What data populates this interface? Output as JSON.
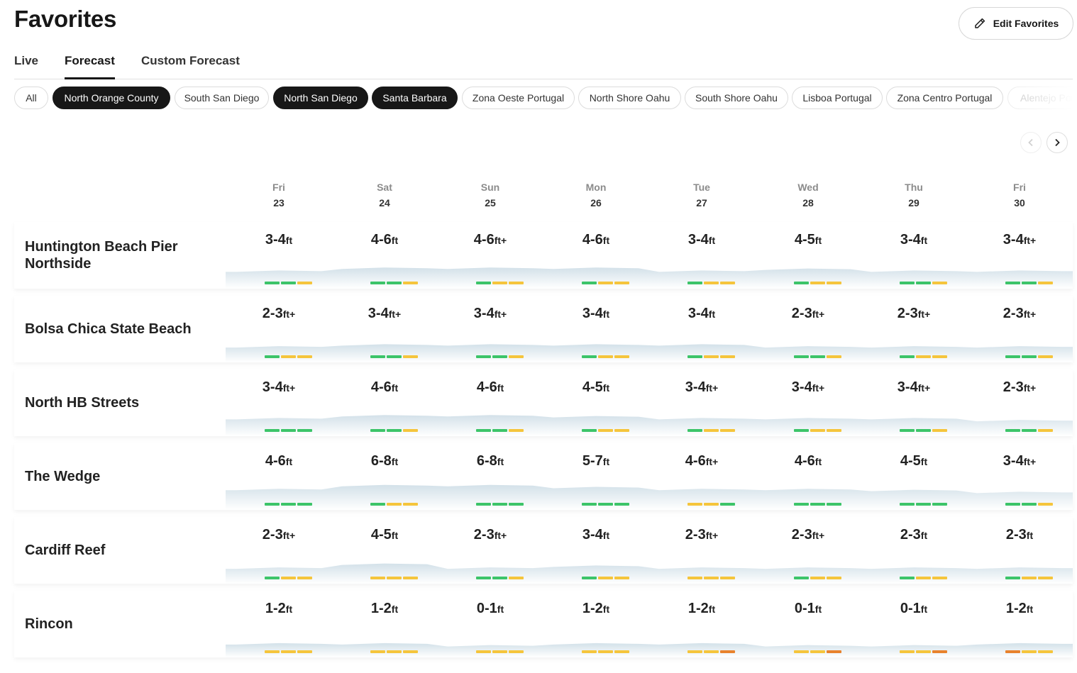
{
  "page_title": "Favorites",
  "edit_button_label": "Edit Favorites",
  "tabs": [
    {
      "label": "Live",
      "active": false
    },
    {
      "label": "Forecast",
      "active": true
    },
    {
      "label": "Custom Forecast",
      "active": false
    }
  ],
  "chips": [
    {
      "label": "All",
      "selected": false
    },
    {
      "label": "North Orange County",
      "selected": true
    },
    {
      "label": "South San Diego",
      "selected": false
    },
    {
      "label": "North San Diego",
      "selected": true
    },
    {
      "label": "Santa Barbara",
      "selected": true
    },
    {
      "label": "Zona Oeste Portugal",
      "selected": false
    },
    {
      "label": "North Shore Oahu",
      "selected": false
    },
    {
      "label": "South Shore Oahu",
      "selected": false
    },
    {
      "label": "Lisboa Portugal",
      "selected": false
    },
    {
      "label": "Zona Centro Portugal",
      "selected": false
    },
    {
      "label": "Alentejo Portugal",
      "selected": false
    }
  ],
  "days": [
    {
      "name": "Fri",
      "num": "23"
    },
    {
      "name": "Sat",
      "num": "24"
    },
    {
      "name": "Sun",
      "num": "25"
    },
    {
      "name": "Mon",
      "num": "26"
    },
    {
      "name": "Tue",
      "num": "27"
    },
    {
      "name": "Wed",
      "num": "28"
    },
    {
      "name": "Thu",
      "num": "29"
    },
    {
      "name": "Fri",
      "num": "30"
    }
  ],
  "colors": {
    "good": "#3cc469",
    "fair": "#f5c53c",
    "poor": "#e8822d",
    "wave": "#d3e1e9"
  },
  "spots": [
    {
      "name": "Huntington Beach Pier Northside",
      "forecasts": [
        {
          "range": "3-4",
          "unit": "ft",
          "ratings": [
            "good",
            "good",
            "fair"
          ]
        },
        {
          "range": "4-6",
          "unit": "ft",
          "ratings": [
            "good",
            "good",
            "fair"
          ]
        },
        {
          "range": "4-6",
          "unit": "ft+",
          "ratings": [
            "good",
            "fair",
            "fair"
          ]
        },
        {
          "range": "4-6",
          "unit": "ft",
          "ratings": [
            "good",
            "fair",
            "fair"
          ]
        },
        {
          "range": "3-4",
          "unit": "ft",
          "ratings": [
            "good",
            "fair",
            "fair"
          ]
        },
        {
          "range": "4-5",
          "unit": "ft",
          "ratings": [
            "good",
            "fair",
            "fair"
          ]
        },
        {
          "range": "3-4",
          "unit": "ft",
          "ratings": [
            "good",
            "good",
            "fair"
          ]
        },
        {
          "range": "3-4",
          "unit": "ft+",
          "ratings": [
            "good",
            "good",
            "fair"
          ]
        }
      ]
    },
    {
      "name": "Bolsa Chica State Beach",
      "forecasts": [
        {
          "range": "2-3",
          "unit": "ft+",
          "ratings": [
            "good",
            "fair",
            "fair"
          ]
        },
        {
          "range": "3-4",
          "unit": "ft+",
          "ratings": [
            "good",
            "good",
            "fair"
          ]
        },
        {
          "range": "3-4",
          "unit": "ft+",
          "ratings": [
            "good",
            "good",
            "fair"
          ]
        },
        {
          "range": "3-4",
          "unit": "ft",
          "ratings": [
            "good",
            "fair",
            "fair"
          ]
        },
        {
          "range": "3-4",
          "unit": "ft",
          "ratings": [
            "good",
            "fair",
            "fair"
          ]
        },
        {
          "range": "2-3",
          "unit": "ft+",
          "ratings": [
            "good",
            "good",
            "fair"
          ]
        },
        {
          "range": "2-3",
          "unit": "ft+",
          "ratings": [
            "good",
            "fair",
            "fair"
          ]
        },
        {
          "range": "2-3",
          "unit": "ft+",
          "ratings": [
            "good",
            "good",
            "fair"
          ]
        }
      ]
    },
    {
      "name": "North HB Streets",
      "forecasts": [
        {
          "range": "3-4",
          "unit": "ft+",
          "ratings": [
            "good",
            "good",
            "good"
          ]
        },
        {
          "range": "4-6",
          "unit": "ft",
          "ratings": [
            "good",
            "good",
            "fair"
          ]
        },
        {
          "range": "4-6",
          "unit": "ft",
          "ratings": [
            "good",
            "good",
            "fair"
          ]
        },
        {
          "range": "4-5",
          "unit": "ft",
          "ratings": [
            "good",
            "fair",
            "fair"
          ]
        },
        {
          "range": "3-4",
          "unit": "ft+",
          "ratings": [
            "good",
            "fair",
            "fair"
          ]
        },
        {
          "range": "3-4",
          "unit": "ft+",
          "ratings": [
            "good",
            "fair",
            "fair"
          ]
        },
        {
          "range": "3-4",
          "unit": "ft+",
          "ratings": [
            "good",
            "good",
            "fair"
          ]
        },
        {
          "range": "2-3",
          "unit": "ft+",
          "ratings": [
            "good",
            "good",
            "fair"
          ]
        }
      ]
    },
    {
      "name": "The Wedge",
      "forecasts": [
        {
          "range": "4-6",
          "unit": "ft",
          "ratings": [
            "good",
            "good",
            "good"
          ]
        },
        {
          "range": "6-8",
          "unit": "ft",
          "ratings": [
            "good",
            "fair",
            "fair"
          ]
        },
        {
          "range": "6-8",
          "unit": "ft",
          "ratings": [
            "good",
            "good",
            "good"
          ]
        },
        {
          "range": "5-7",
          "unit": "ft",
          "ratings": [
            "good",
            "good",
            "good"
          ]
        },
        {
          "range": "4-6",
          "unit": "ft+",
          "ratings": [
            "fair",
            "fair",
            "good"
          ]
        },
        {
          "range": "4-6",
          "unit": "ft",
          "ratings": [
            "good",
            "good",
            "good"
          ]
        },
        {
          "range": "4-5",
          "unit": "ft",
          "ratings": [
            "good",
            "good",
            "good"
          ]
        },
        {
          "range": "3-4",
          "unit": "ft+",
          "ratings": [
            "good",
            "good",
            "fair"
          ]
        }
      ]
    },
    {
      "name": "Cardiff Reef",
      "forecasts": [
        {
          "range": "2-3",
          "unit": "ft+",
          "ratings": [
            "good",
            "fair",
            "fair"
          ]
        },
        {
          "range": "4-5",
          "unit": "ft",
          "ratings": [
            "fair",
            "fair",
            "fair"
          ]
        },
        {
          "range": "2-3",
          "unit": "ft+",
          "ratings": [
            "good",
            "good",
            "fair"
          ]
        },
        {
          "range": "3-4",
          "unit": "ft",
          "ratings": [
            "good",
            "fair",
            "fair"
          ]
        },
        {
          "range": "2-3",
          "unit": "ft+",
          "ratings": [
            "fair",
            "fair",
            "fair"
          ]
        },
        {
          "range": "2-3",
          "unit": "ft+",
          "ratings": [
            "good",
            "fair",
            "fair"
          ]
        },
        {
          "range": "2-3",
          "unit": "ft",
          "ratings": [
            "good",
            "fair",
            "fair"
          ]
        },
        {
          "range": "2-3",
          "unit": "ft",
          "ratings": [
            "good",
            "fair",
            "fair"
          ]
        }
      ]
    },
    {
      "name": "Rincon",
      "forecasts": [
        {
          "range": "1-2",
          "unit": "ft",
          "ratings": [
            "fair",
            "fair",
            "fair"
          ]
        },
        {
          "range": "1-2",
          "unit": "ft",
          "ratings": [
            "fair",
            "fair",
            "fair"
          ]
        },
        {
          "range": "0-1",
          "unit": "ft",
          "ratings": [
            "fair",
            "fair",
            "fair"
          ]
        },
        {
          "range": "1-2",
          "unit": "ft",
          "ratings": [
            "fair",
            "fair",
            "fair"
          ]
        },
        {
          "range": "1-2",
          "unit": "ft",
          "ratings": [
            "fair",
            "fair",
            "poor"
          ]
        },
        {
          "range": "0-1",
          "unit": "ft",
          "ratings": [
            "fair",
            "fair",
            "poor"
          ]
        },
        {
          "range": "0-1",
          "unit": "ft",
          "ratings": [
            "fair",
            "fair",
            "poor"
          ]
        },
        {
          "range": "1-2",
          "unit": "ft",
          "ratings": [
            "poor",
            "fair",
            "fair"
          ]
        }
      ]
    }
  ]
}
